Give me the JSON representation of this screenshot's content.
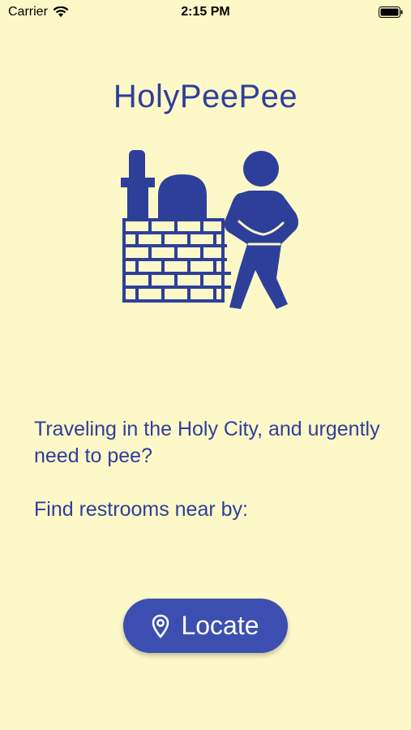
{
  "status_bar": {
    "carrier": "Carrier",
    "time": "2:15 PM",
    "wifi_icon": "wifi-icon",
    "battery_icon": "battery-icon"
  },
  "app": {
    "title": "HolyPeePee",
    "logo": "man-peeing-on-wall-logo"
  },
  "content": {
    "intro_text": "Traveling in the Holy City, and urgently need to pee?",
    "find_text": "Find restrooms near by:"
  },
  "locate_button": {
    "label": "Locate",
    "icon": "location-pin-icon"
  },
  "colors": {
    "background": "#fdf8c8",
    "primary": "#2e3f9a",
    "button": "#3c4fb1"
  }
}
